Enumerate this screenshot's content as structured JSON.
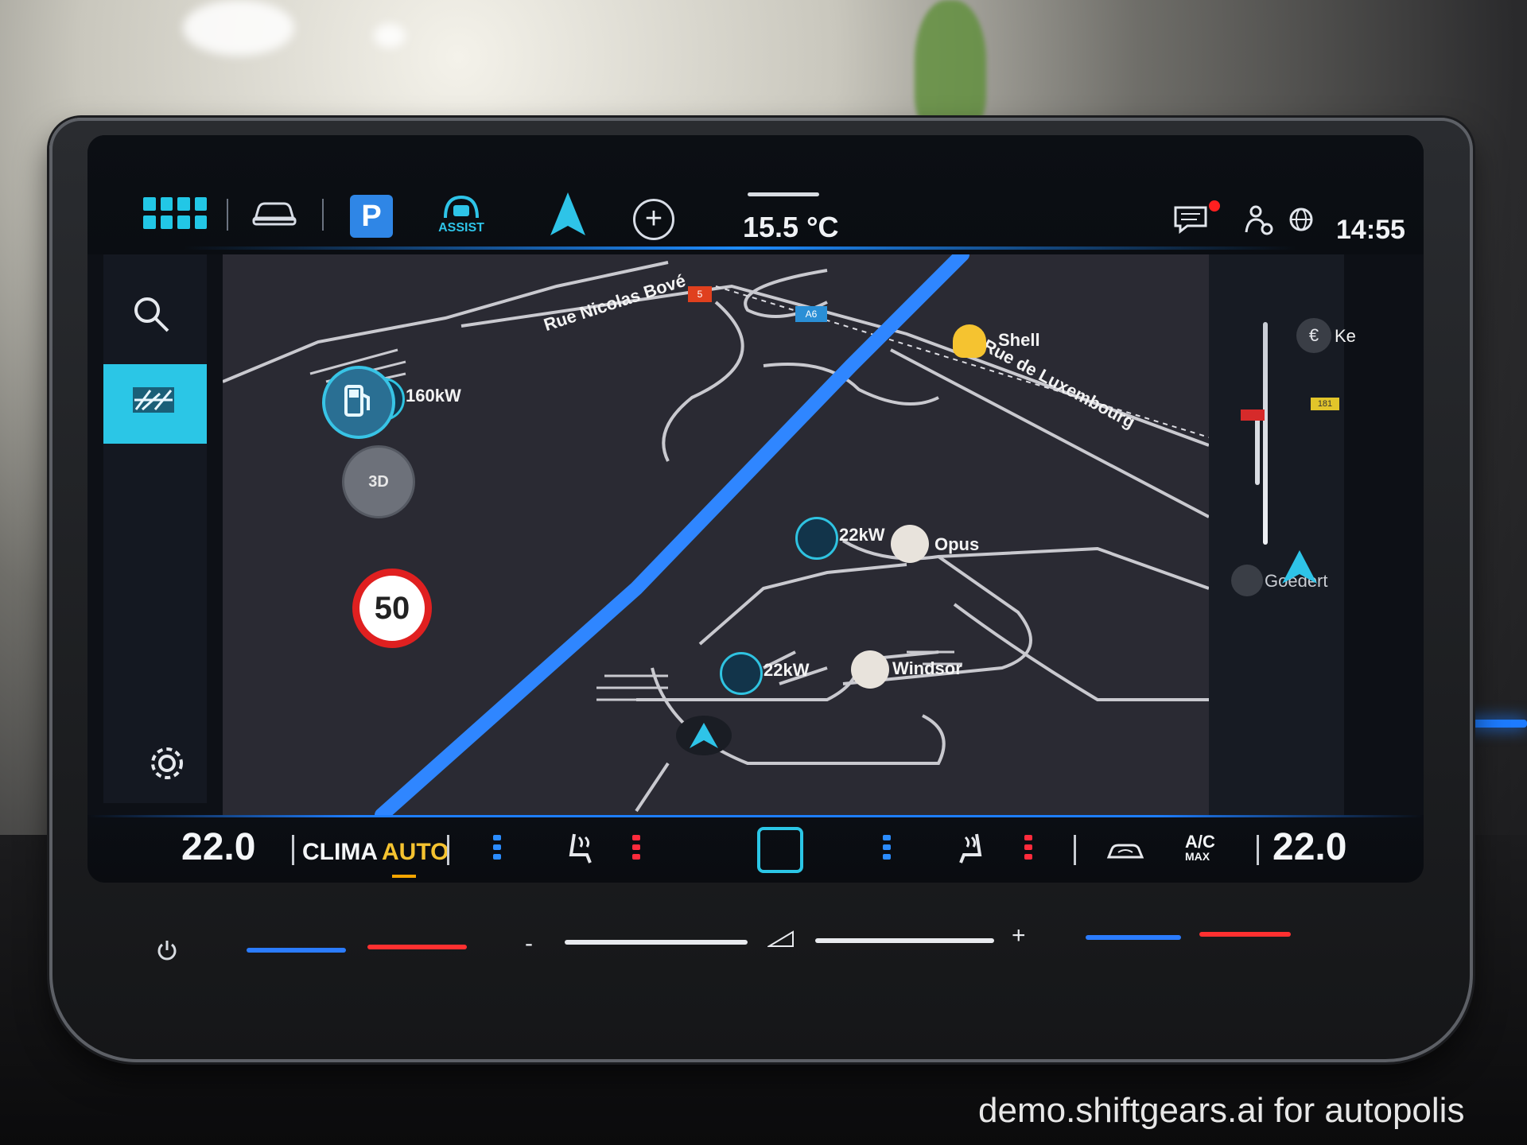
{
  "topbar": {
    "assist_label": "ASSIST",
    "parking_label": "P",
    "outside_temp": "15.5 °C",
    "clock": "14:55",
    "icons": [
      "apps-grid-icon",
      "car-icon",
      "parking-icon",
      "assist-icon",
      "navigation-arrow-icon",
      "add-icon",
      "message-icon",
      "person-location-icon",
      "globe-icon"
    ]
  },
  "map": {
    "streets": [
      "Rue Nicolas Bové",
      "Rue de Luxembourg"
    ],
    "road_badges": [
      "5",
      "A6",
      "181"
    ],
    "pois": [
      {
        "label": "160kW",
        "type": "charging"
      },
      {
        "label": "Shell",
        "type": "fuel"
      },
      {
        "label": "22kW",
        "type": "charging"
      },
      {
        "label": "Opus",
        "type": "restaurant"
      },
      {
        "label": "22kW",
        "type": "charging"
      },
      {
        "label": "Windsor",
        "type": "restaurant"
      },
      {
        "label": "Goedert",
        "type": "service"
      },
      {
        "label": "Ke",
        "type": "toll"
      }
    ],
    "speed_limit": "50",
    "view_3d": "3D",
    "route_color": "#2f86ff"
  },
  "climate": {
    "left_temp": "22.0",
    "right_temp": "22.0",
    "clima_label": "CLIMA",
    "auto_label": "AUTO",
    "ac_label": "A/C",
    "max_label": "MAX",
    "auto_color": "#f5c330"
  },
  "controls": {
    "minus": "-",
    "plus": "+"
  },
  "watermark": "demo.shiftgears.ai for autopolis"
}
